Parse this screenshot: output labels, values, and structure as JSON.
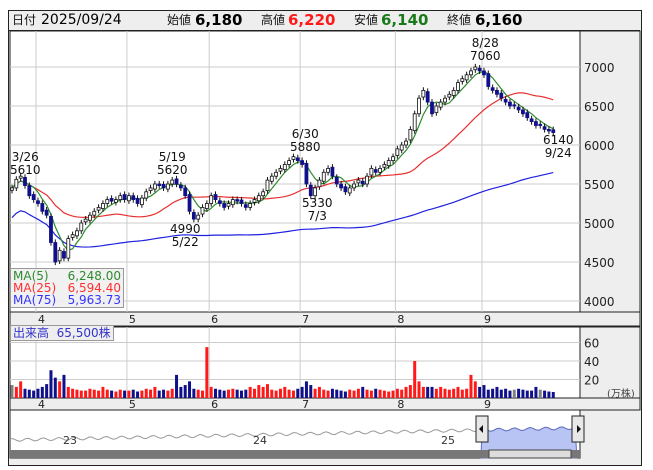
{
  "header": {
    "date_label": "日付",
    "date": "2025/09/24",
    "open_label": "始値",
    "open": "6,180",
    "high_label": "高値",
    "high": "6,220",
    "low_label": "安値",
    "low": "6,140",
    "close_label": "終値",
    "close": "6,160"
  },
  "legend": {
    "ma5_label": "MA(5)",
    "ma5": "6,248.00",
    "ma25_label": "MA(25)",
    "ma25": "6,594.40",
    "ma75_label": "MA(75)",
    "ma75": "5,963.73"
  },
  "volume": {
    "label": "出来高",
    "value": "65,500株",
    "unit": "(万株)"
  },
  "colors": {
    "ma5": "#2e8b2e",
    "ma25": "#e83030",
    "ma75": "#2020e0",
    "up_vol": "#ff1a1a",
    "down_vol": "#10108a",
    "even_vol": "#808080",
    "nav_fill": "#b8c4f4"
  },
  "annotations": [
    {
      "date": "3/26",
      "price": "5610"
    },
    {
      "date": "5/19",
      "price": "5620"
    },
    {
      "date": "5/22",
      "price": "4990"
    },
    {
      "date": "6/30",
      "price": "5880"
    },
    {
      "date": "7/3",
      "price": "5330"
    },
    {
      "date": "8/28",
      "price": "7060"
    },
    {
      "date": "9/24",
      "price": "6140"
    }
  ],
  "navigator": {
    "year_labels": [
      "23",
      "24",
      "25"
    ]
  },
  "chart_data": {
    "type": "candlestick",
    "price_ticks": [
      "7000",
      "6500",
      "6000",
      "5500",
      "5000",
      "4500",
      "4000"
    ],
    "price_range": [
      3950,
      7400
    ],
    "volume_ticks": [
      "60",
      "40",
      "20"
    ],
    "volume_range": [
      0,
      70
    ],
    "month_labels": [
      "4",
      "5",
      "6",
      "7",
      "8",
      "9"
    ],
    "month_start_index": [
      6,
      27,
      46,
      67,
      89,
      109
    ],
    "closes": [
      5450,
      5560,
      5600,
      5480,
      5350,
      5300,
      5250,
      5150,
      5100,
      4750,
      4500,
      4650,
      4550,
      4800,
      4850,
      4900,
      5000,
      5050,
      5100,
      5150,
      5200,
      5250,
      5300,
      5280,
      5300,
      5350,
      5300,
      5350,
      5300,
      5250,
      5320,
      5400,
      5450,
      5500,
      5480,
      5450,
      5500,
      5550,
      5500,
      5450,
      5350,
      5150,
      5050,
      5100,
      5200,
      5250,
      5350,
      5300,
      5250,
      5200,
      5250,
      5300,
      5280,
      5250,
      5200,
      5250,
      5300,
      5350,
      5400,
      5550,
      5600,
      5650,
      5700,
      5750,
      5800,
      5850,
      5800,
      5750,
      5500,
      5350,
      5450,
      5550,
      5650,
      5700,
      5600,
      5500,
      5450,
      5400,
      5450,
      5500,
      5550,
      5500,
      5600,
      5700,
      5650,
      5700,
      5750,
      5800,
      5850,
      5950,
      6000,
      6050,
      6200,
      6400,
      6600,
      6700,
      6550,
      6400,
      6500,
      6550,
      6600,
      6650,
      6700,
      6800,
      6850,
      6900,
      6950,
      7000,
      6950,
      6900,
      6750,
      6700,
      6650,
      6600,
      6550,
      6500,
      6500,
      6450,
      6400,
      6350,
      6300,
      6250,
      6250,
      6200,
      6180,
      6160
    ],
    "volumes": [
      14,
      12,
      18,
      10,
      9,
      8,
      10,
      12,
      15,
      30,
      22,
      18,
      25,
      12,
      10,
      9,
      8,
      8,
      10,
      9,
      8,
      12,
      9,
      8,
      7,
      9,
      8,
      8,
      9,
      7,
      8,
      10,
      9,
      12,
      8,
      9,
      8,
      10,
      25,
      12,
      14,
      18,
      10,
      9,
      8,
      55,
      12,
      10,
      9,
      8,
      9,
      10,
      9,
      8,
      9,
      12,
      10,
      14,
      12,
      15,
      9,
      8,
      10,
      12,
      9,
      8,
      10,
      12,
      18,
      14,
      10,
      12,
      9,
      8,
      10,
      9,
      8,
      7,
      9,
      8,
      10,
      12,
      9,
      8,
      10,
      9,
      8,
      7,
      8,
      10,
      9,
      12,
      14,
      40,
      18,
      12,
      12,
      12,
      10,
      12,
      10,
      9,
      10,
      12,
      9,
      10,
      25,
      18,
      12,
      14,
      9,
      10,
      12,
      9,
      10,
      8,
      9,
      10,
      9,
      8,
      8,
      12,
      9,
      8,
      7,
      6.5
    ]
  }
}
